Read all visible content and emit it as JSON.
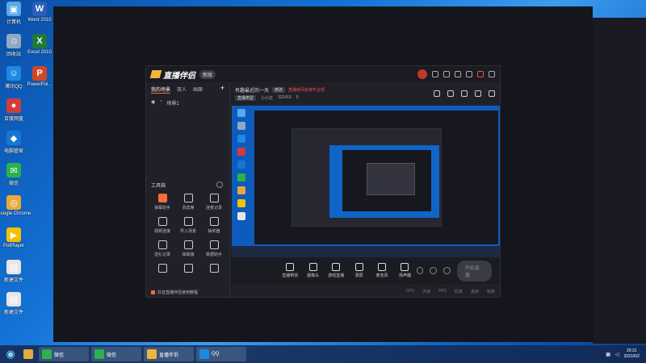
{
  "desktop": {
    "icons": [
      {
        "label": "计算机",
        "color": "#5aa7e8",
        "glyph": "▣"
      },
      {
        "label": "回收站",
        "color": "#8fa9c4",
        "glyph": "♲"
      },
      {
        "label": "腾讯QQ",
        "color": "#1e88e5",
        "glyph": "☺"
      },
      {
        "label": "百度网盘",
        "color": "#d23c3c",
        "glyph": "●"
      },
      {
        "label": "电脑管家",
        "color": "#1976d2",
        "glyph": "◆"
      },
      {
        "label": "微信",
        "color": "#2bb24c",
        "glyph": "✉"
      },
      {
        "label": "Google Chrome",
        "color": "#e8a93b",
        "glyph": "◎"
      },
      {
        "label": "PotPlayer",
        "color": "#f2c200",
        "glyph": "▶"
      },
      {
        "label": "新建文件",
        "color": "#e6e6e6",
        "glyph": "▤"
      },
      {
        "label": "新建文件",
        "color": "#e6e6e6",
        "glyph": "▤"
      }
    ],
    "icons_col2": [
      {
        "label": "Word 2010",
        "color": "#2b5fb8",
        "glyph": "W"
      },
      {
        "label": "Excel 2010",
        "color": "#1f7a3a",
        "glyph": "X"
      },
      {
        "label": "PowerPoi...",
        "color": "#d24726",
        "glyph": "P"
      }
    ]
  },
  "app": {
    "logo": "直播伴侣",
    "badge": "新版",
    "tabs": [
      "我的场景",
      "双人",
      "画面"
    ],
    "scene_item": "场景1",
    "tools_title": "工具箱",
    "tools": [
      {
        "label": "弹幕助手",
        "hot": true
      },
      {
        "label": "贵宾席",
        "hot": false
      },
      {
        "label": "连麦记录",
        "hot": false
      },
      {
        "label": "视频连接",
        "hot": false
      },
      {
        "label": "导入场景",
        "hot": false
      },
      {
        "label": "抽奖器",
        "hot": false
      },
      {
        "label": "送礼记录",
        "hot": false
      },
      {
        "label": "弹幕播",
        "hot": false
      },
      {
        "label": "数据助手",
        "hot": false
      },
      {
        "label": "",
        "hot": false
      },
      {
        "label": "",
        "hot": false
      },
      {
        "label": "",
        "hot": false
      }
    ],
    "tip": "抖音直播伴侣使用教程",
    "room_title": "有趣最近的一天",
    "room_tag": "修改",
    "room_warning": "直播房间名称不合规",
    "room_meta": {
      "category": "直播类型",
      "name": "小小达",
      "id": "322419",
      "likes": "0"
    },
    "bottom_buttons": [
      "直播带货",
      "摄像头",
      "游戏直播",
      "录屏",
      "麦克风",
      "扬声器"
    ],
    "go_live": "开始直播",
    "status": [
      "CPU",
      "内存",
      "FPS",
      "码率",
      "丢帧",
      "帧率"
    ]
  },
  "taskbar": {
    "items": [
      {
        "label": "",
        "color": "#e8a93b"
      },
      {
        "label": "微信",
        "color": "#2bb24c"
      },
      {
        "label": "微信",
        "color": "#2bb24c"
      },
      {
        "label": "直播伴侣",
        "color": "#f0b63a"
      },
      {
        "label": "QQ",
        "color": "#1e88e5"
      }
    ],
    "time": "20:31",
    "date": "2021/6/2"
  }
}
